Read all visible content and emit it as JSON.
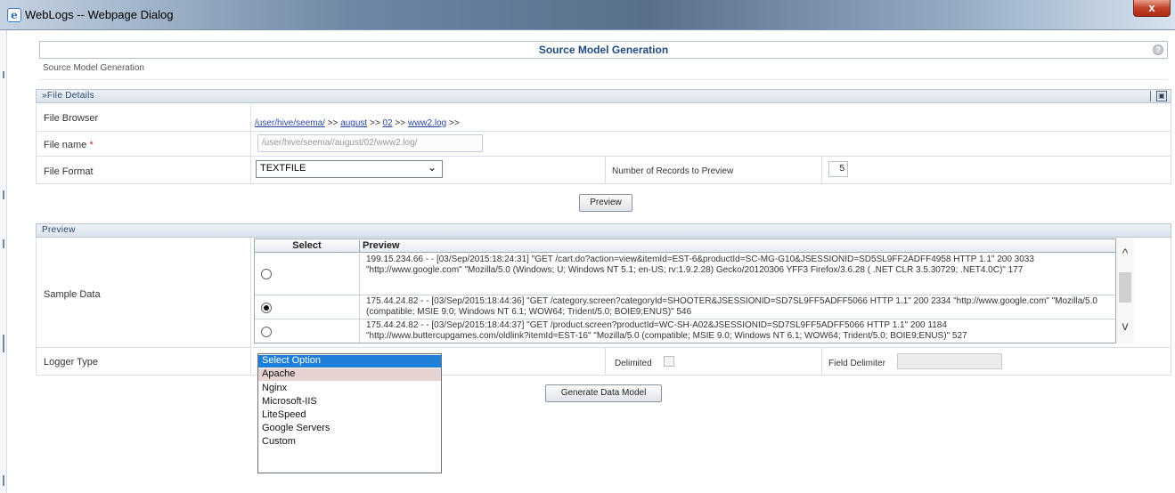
{
  "window": {
    "title": "WebLogs -- Webpage Dialog",
    "icon": "ie-icon",
    "close_label": "x"
  },
  "page": {
    "title": "Source Model Generation",
    "breadcrumb": "Source Model Generation",
    "help_label": "?"
  },
  "file_details": {
    "section_title": "»File Details",
    "file_browser_label": "File Browser",
    "path_links": [
      "/user/hive/seema/",
      "august",
      "02",
      "www2.log"
    ],
    "path_sep": ">>",
    "file_name_label": "File name",
    "file_name_required": "*",
    "file_name_value": "/user/hive/seema//august/02/www2.log/",
    "file_format_label": "File Format",
    "file_format_value": "TEXTFILE",
    "records_label": "Number of Records to Preview",
    "records_value": "5",
    "preview_button": "Preview"
  },
  "preview": {
    "section_title": "Preview",
    "sample_data_label": "Sample Data",
    "columns": [
      "Select",
      "Preview"
    ],
    "rows": [
      {
        "selected": false,
        "text": "199.15.234.66 - - [03/Sep/2015:18:24:31] \"GET /cart.do?action=view&itemId=EST-6&productId=SC-MG-G10&JSESSIONID=SD5SL9FF2ADFF4958 HTTP 1.1\" 200 3033 \"http://www.google.com\" \"Mozilla/5.0 (Windows; U; Windows NT 5.1; en-US; rv:1.9.2.28) Gecko/20120306 YFF3 Firefox/3.6.28 ( .NET CLR 3.5.30729; .NET4.0C)\" 177"
      },
      {
        "selected": true,
        "text": "175.44.24.82 - - [03/Sep/2015:18:44:36] \"GET /category.screen?categoryId=SHOOTER&JSESSIONID=SD7SL9FF5ADFF5066 HTTP 1.1\" 200 2334 \"http://www.google.com\" \"Mozilla/5.0 (compatible; MSIE 9.0; Windows NT 6.1; WOW64; Trident/5.0; BOIE9;ENUS)\" 546"
      },
      {
        "selected": false,
        "text": "175.44.24.82 - - [03/Sep/2015:18:44:37] \"GET /product.screen?productId=WC-SH-A02&JSESSIONID=SD7SL9FF5ADFF5066 HTTP 1.1\" 200 1184 \"http://www.buttercupgames.com/oldlink?itemId=EST-16\" \"Mozilla/5.0 (compatible; MSIE 9.0; Windows NT 6.1; WOW64; Trident/5.0; BOIE9;ENUS)\" 527"
      }
    ],
    "logger_type_label": "Logger Type",
    "logger_options": [
      "Select Option",
      "Apache",
      "Nginx",
      "Microsoft-IIS",
      "LiteSpeed",
      "Google Servers",
      "Custom"
    ],
    "logger_selected": "Select Option",
    "delimited_label": "Delimited",
    "field_delimiter_label": "Field Delimiter",
    "field_delimiter_value": "",
    "generate_button": "Generate Data Model"
  },
  "icons": {
    "scroll_up": "^",
    "scroll_down": "v",
    "chevron": "⌄",
    "save": "▣"
  },
  "colors": {
    "header_text": "#1f4a82",
    "link": "#2a47a8",
    "dropdown_selected": "#1e7fd8",
    "dropdown_hover": "#e7d2d2"
  }
}
